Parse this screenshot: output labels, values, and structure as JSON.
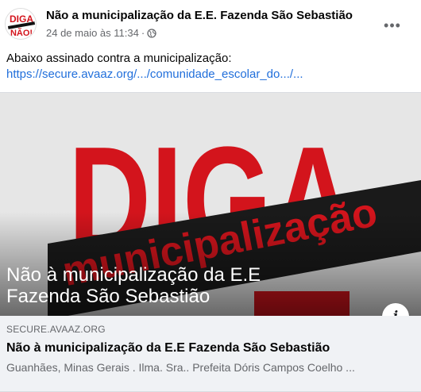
{
  "post": {
    "author": "Não a municipalização da E.E. Fazenda São Sebastião",
    "timestamp": "24 de maio às 11:34",
    "separator": "·",
    "privacy_icon": "globe-icon",
    "more_label": "•••",
    "text": "Abaixo assinado contra a municipalização:",
    "link_text": "https://secure.avaaz.org/.../comunidade_escolar_do.../..."
  },
  "avatar": {
    "line1": "DIGA",
    "line2": "NÃO!"
  },
  "preview": {
    "image_word": "DIGA",
    "image_banner": "municipalização",
    "overlay_title_line1": "Não à municipalização da E.E",
    "overlay_title_line2": "Fazenda São Sebastião",
    "info_label": "i",
    "domain": "SECURE.AVAAZ.ORG",
    "title": "Não à municipalização da E.E Fazenda São Sebastião",
    "description": "Guanhães, Minas Gerais . Ilma. Sra.. Prefeita Dóris Campos Coelho ..."
  },
  "colors": {
    "link": "#216fdb",
    "secondary_text": "#65676b",
    "preview_bg": "#f0f2f5",
    "poster_red": "#d3141c"
  }
}
